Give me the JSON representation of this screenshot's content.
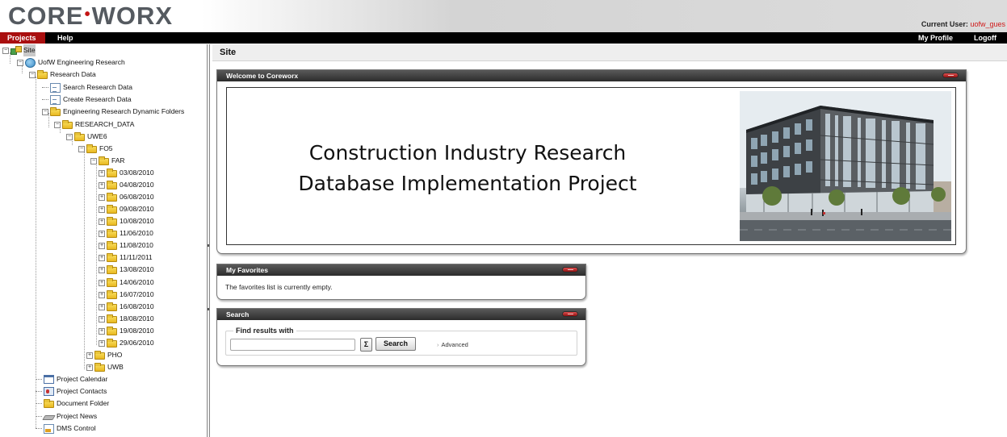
{
  "header": {
    "logo_left": "CORE",
    "logo_dot": "•",
    "logo_right": "WORX",
    "current_user_label": "Current User:",
    "current_user_name": "uofw_gues"
  },
  "nav": {
    "projects": "Projects",
    "help": "Help",
    "my_profile": "My Profile",
    "logoff": "Logoff"
  },
  "tree": {
    "site": "Site",
    "project": "UofW Engineering Research",
    "research_data": "Research Data",
    "search_research_data": "Search Research Data",
    "create_research_data": "Create Research Data",
    "dynamic_folders": "Engineering Research Dynamic Folders",
    "research_data_folder": "RESEARCH_DATA",
    "uwe6": "UWE6",
    "fo5": "FO5",
    "far": "FAR",
    "dates": [
      "03/08/2010",
      "04/08/2010",
      "06/08/2010",
      "09/08/2010",
      "10/08/2010",
      "11/06/2010",
      "11/08/2010",
      "11/11/2011",
      "13/08/2010",
      "14/06/2010",
      "16/07/2010",
      "16/08/2010",
      "18/08/2010",
      "19/08/2010",
      "29/06/2010"
    ],
    "pho": "PHO",
    "uwb": "UWB",
    "project_calendar": "Project Calendar",
    "project_contacts": "Project Contacts",
    "document_folder": "Document Folder",
    "project_news": "Project News",
    "dms_control": "DMS Control"
  },
  "main": {
    "title": "Site",
    "welcome": {
      "header": "Welcome to Coreworx",
      "line1": "Construction Industry Research",
      "line2": "Database Implementation Project"
    },
    "favorites": {
      "header": "My Favorites",
      "empty_text": "The favorites list is currently empty."
    },
    "search": {
      "header": "Search",
      "legend": "Find results with",
      "input_value": "",
      "sigma_label": "Σ",
      "button_label": "Search",
      "advanced_label": "Advanced"
    }
  },
  "colors": {
    "nav_active": "#a90f0f",
    "nav_bar": "#000000",
    "panel_header": "#3a3a3a",
    "current_user_name": "#d01818"
  }
}
